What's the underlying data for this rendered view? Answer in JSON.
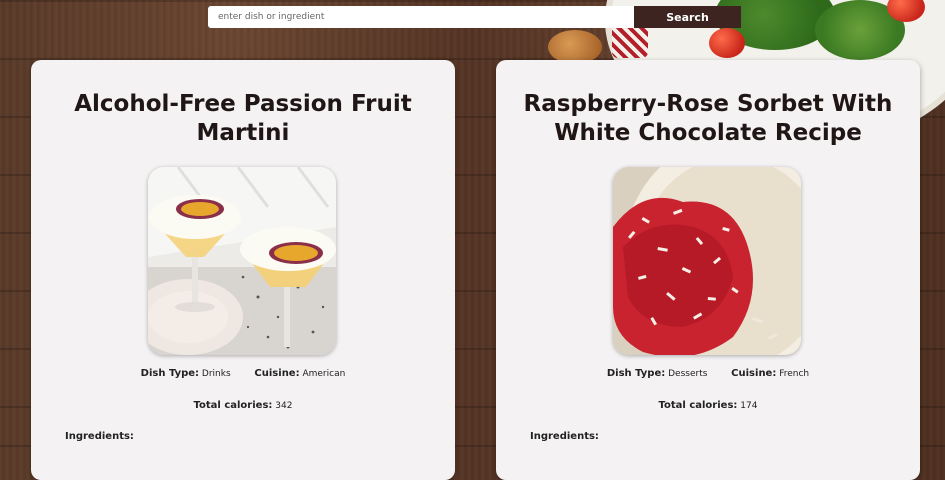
{
  "search": {
    "placeholder": "enter dish or ingredient",
    "button_label": "Search"
  },
  "recipes": [
    {
      "title": "Alcohol-Free Passion Fruit Martini",
      "dish_type_label": "Dish Type:",
      "dish_type": "Drinks",
      "cuisine_label": "Cuisine:",
      "cuisine": "American",
      "calories_label": "Total calories:",
      "calories": "342",
      "ingredients_label": "Ingredients:"
    },
    {
      "title": "Raspberry-Rose Sorbet With White Chocolate Recipe",
      "dish_type_label": "Dish Type:",
      "dish_type": "Desserts",
      "cuisine_label": "Cuisine:",
      "cuisine": "French",
      "calories_label": "Total calories:",
      "calories": "174",
      "ingredients_label": "Ingredients:"
    }
  ],
  "colors": {
    "button_bg": "#3d2420",
    "card_bg": "#f4f2f3",
    "title_text": "#1f1615"
  }
}
